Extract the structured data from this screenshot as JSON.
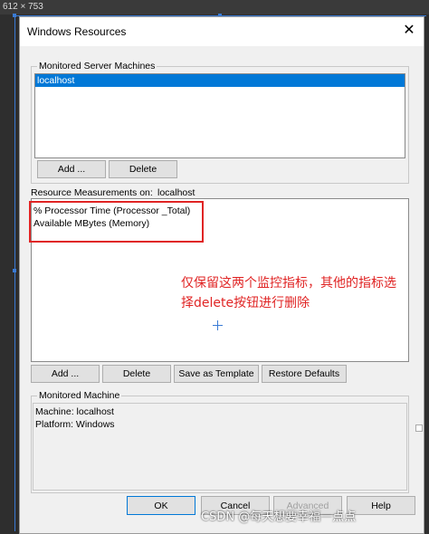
{
  "canvas_size_label": "612 × 753",
  "dialog": {
    "title": "Windows Resources",
    "close_glyph": "✕"
  },
  "servers": {
    "group_label": "Monitored Server Machines",
    "items": [
      "localhost"
    ],
    "add_label": "Add ...",
    "delete_label": "Delete"
  },
  "measurements": {
    "label": "Resource Measurements on:",
    "host": "localhost",
    "items": [
      "% Processor Time (Processor _Total)",
      "Available MBytes (Memory)"
    ],
    "add_label": "Add ...",
    "delete_label": "Delete",
    "save_template_label": "Save as Template",
    "restore_defaults_label": "Restore Defaults"
  },
  "annotation": {
    "line1": "仅保留这两个监控指标，其他的指标选",
    "line2": "择delete按钮进行删除",
    "color": "#e02424"
  },
  "machine": {
    "group_label": "Monitored Machine",
    "machine_line": "Machine: localhost",
    "platform_line": "Platform: Windows"
  },
  "footer": {
    "ok_label": "OK",
    "cancel_label": "Cancel",
    "advanced_label": "Advanced",
    "help_label": "Help"
  },
  "watermark": "CSDN @每天想要幸福一点点",
  "colors": {
    "selection": "#0078d7",
    "guide": "#3a7bd5",
    "dialog_bg": "#f0f0f0"
  }
}
